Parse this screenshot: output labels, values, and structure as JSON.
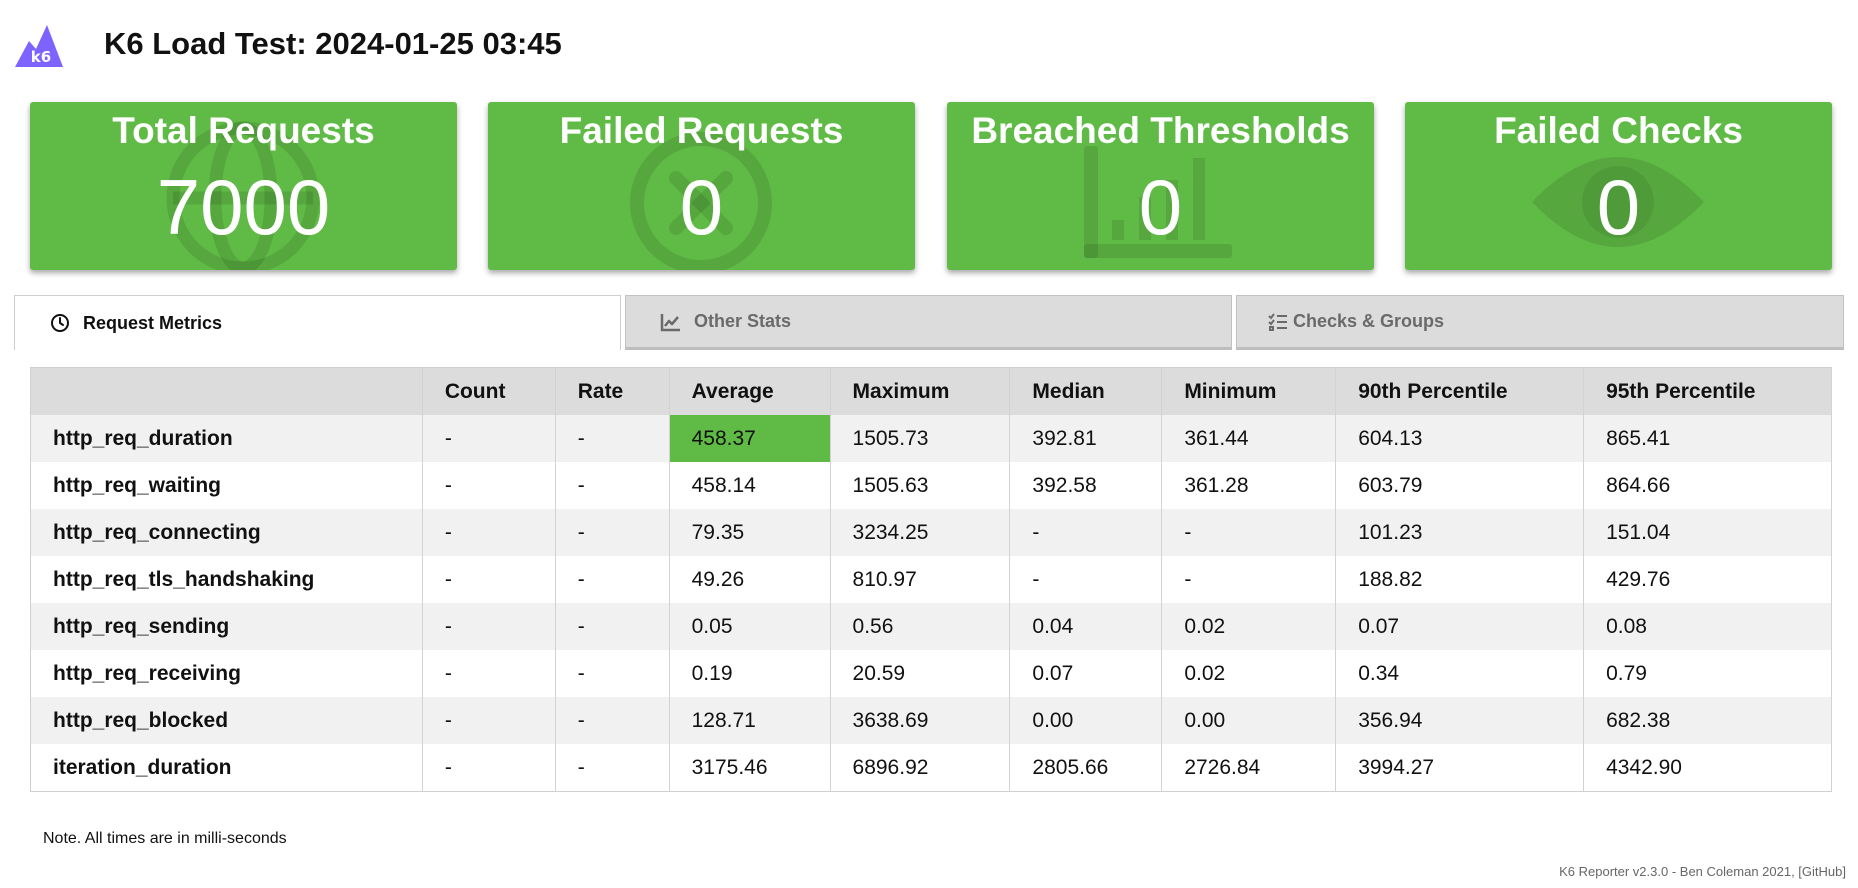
{
  "header": {
    "logo_text": "k6",
    "title": "K6 Load Test: 2024-01-25 03:45"
  },
  "colors": {
    "accent": "#60bb46",
    "logo": "#7d64ff"
  },
  "cards": [
    {
      "label": "Total Requests",
      "value": "7000",
      "icon": "globe-icon"
    },
    {
      "label": "Failed Requests",
      "value": "0",
      "icon": "times-circle-icon"
    },
    {
      "label": "Breached Thresholds",
      "value": "0",
      "icon": "chart-bar-icon"
    },
    {
      "label": "Failed Checks",
      "value": "0",
      "icon": "eye-icon"
    }
  ],
  "tabs": [
    {
      "label": "Request Metrics",
      "icon": "clock-icon",
      "active": true
    },
    {
      "label": "Other Stats",
      "icon": "chart-line-icon",
      "active": false
    },
    {
      "label": "Checks & Groups",
      "icon": "tasks-icon",
      "active": false
    }
  ],
  "table": {
    "columns": [
      "",
      "Count",
      "Rate",
      "Average",
      "Maximum",
      "Median",
      "Minimum",
      "90th Percentile",
      "95th Percentile"
    ],
    "rows": [
      {
        "name": "http_req_duration",
        "count": "-",
        "rate": "-",
        "average": "458.37",
        "maximum": "1505.73",
        "median": "392.81",
        "minimum": "361.44",
        "p90": "604.13",
        "p95": "865.41"
      },
      {
        "name": "http_req_waiting",
        "count": "-",
        "rate": "-",
        "average": "458.14",
        "maximum": "1505.63",
        "median": "392.58",
        "minimum": "361.28",
        "p90": "603.79",
        "p95": "864.66"
      },
      {
        "name": "http_req_connecting",
        "count": "-",
        "rate": "-",
        "average": "79.35",
        "maximum": "3234.25",
        "median": "-",
        "minimum": "-",
        "p90": "101.23",
        "p95": "151.04"
      },
      {
        "name": "http_req_tls_handshaking",
        "count": "-",
        "rate": "-",
        "average": "49.26",
        "maximum": "810.97",
        "median": "-",
        "minimum": "-",
        "p90": "188.82",
        "p95": "429.76"
      },
      {
        "name": "http_req_sending",
        "count": "-",
        "rate": "-",
        "average": "0.05",
        "maximum": "0.56",
        "median": "0.04",
        "minimum": "0.02",
        "p90": "0.07",
        "p95": "0.08"
      },
      {
        "name": "http_req_receiving",
        "count": "-",
        "rate": "-",
        "average": "0.19",
        "maximum": "20.59",
        "median": "0.07",
        "minimum": "0.02",
        "p90": "0.34",
        "p95": "0.79"
      },
      {
        "name": "http_req_blocked",
        "count": "-",
        "rate": "-",
        "average": "128.71",
        "maximum": "3638.69",
        "median": "0.00",
        "minimum": "0.00",
        "p90": "356.94",
        "p95": "682.38"
      },
      {
        "name": "iteration_duration",
        "count": "-",
        "rate": "-",
        "average": "3175.46",
        "maximum": "6896.92",
        "median": "2805.66",
        "minimum": "2726.84",
        "p90": "3994.27",
        "p95": "4342.90"
      }
    ]
  },
  "note": "Note. All times are in milli-seconds",
  "footer": "K6 Reporter v2.3.0 - Ben Coleman 2021, [GitHub]"
}
